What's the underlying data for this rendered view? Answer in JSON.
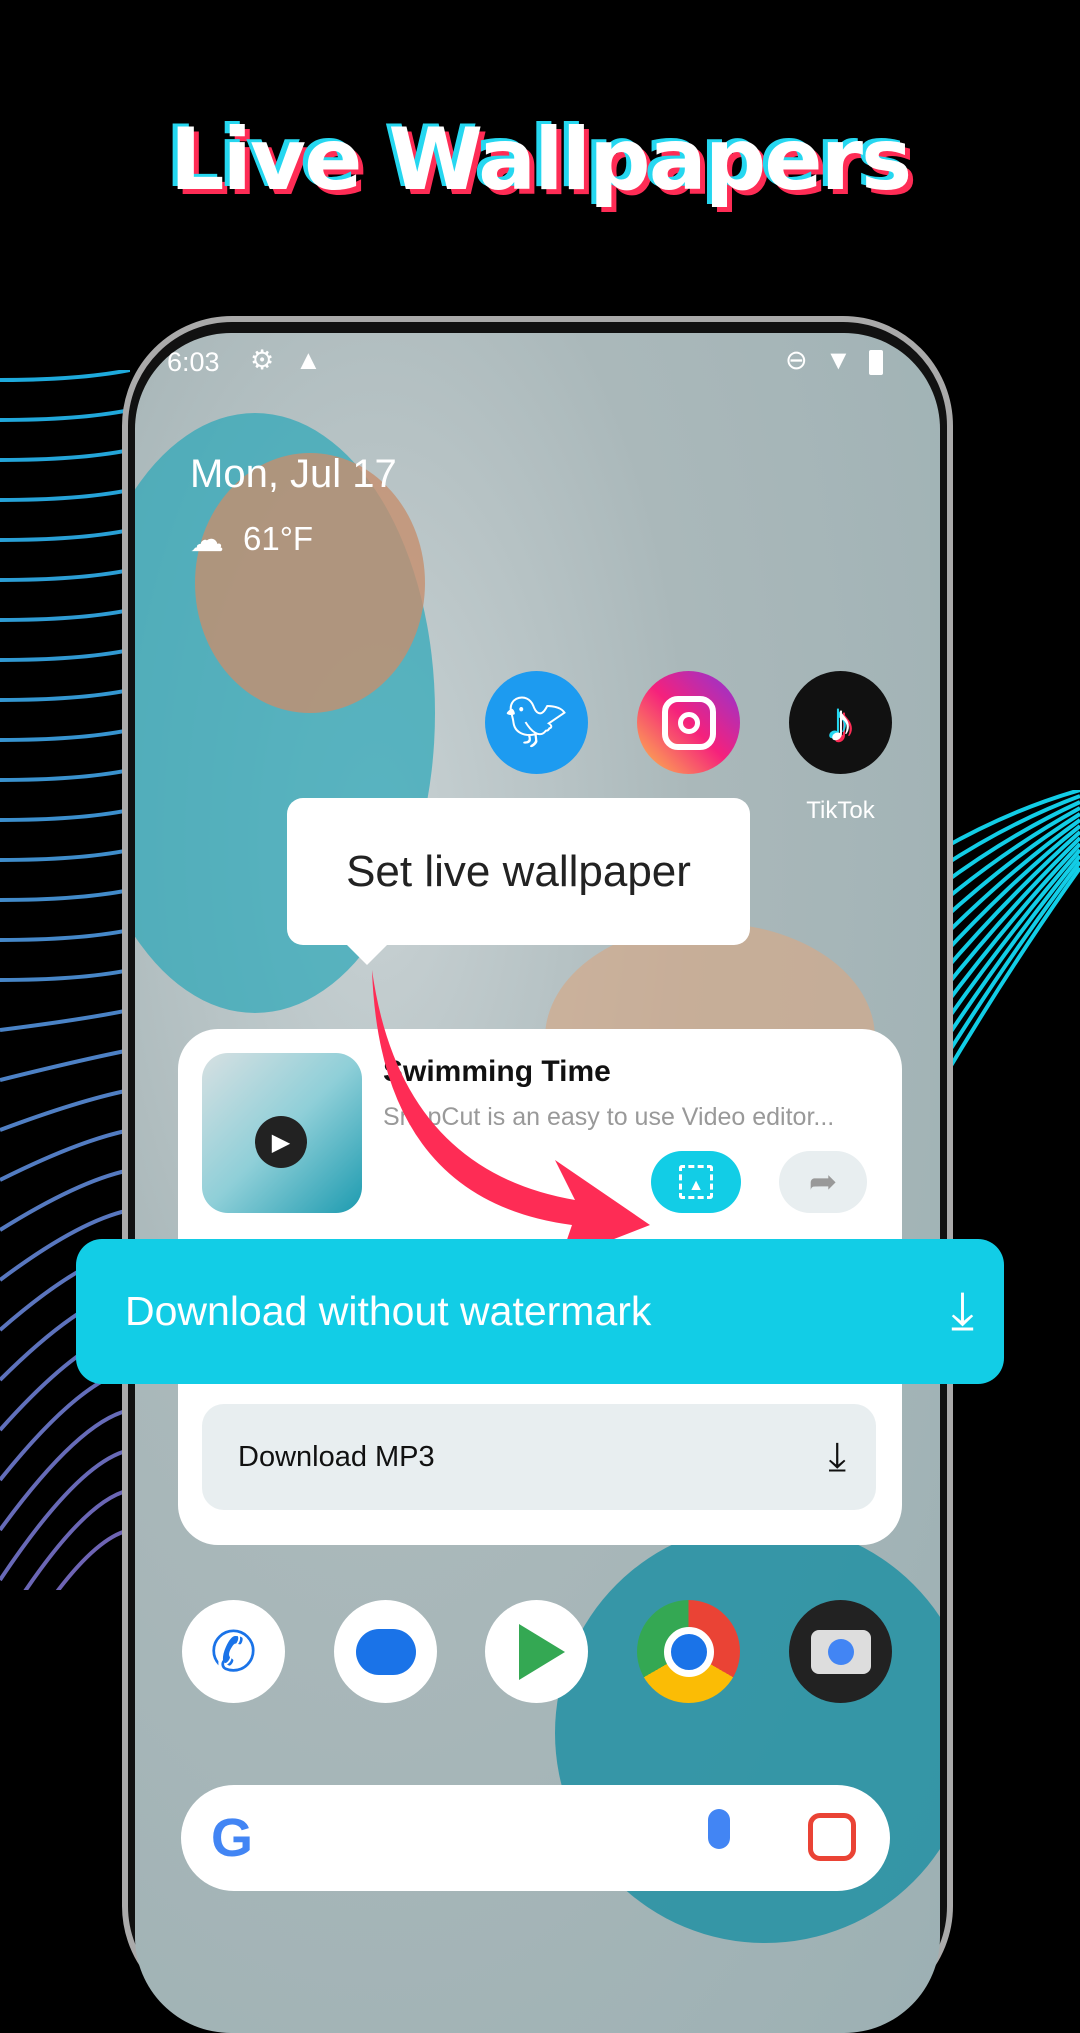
{
  "headline": "Live Wallpapers",
  "status_bar": {
    "time": "6:03",
    "icons": [
      "gear-icon",
      "warning-icon",
      "do-not-disturb-icon",
      "wifi-icon",
      "battery-icon"
    ]
  },
  "widget": {
    "date": "Mon, Jul 17",
    "weather_icon": "cloud-icon",
    "temperature": "61°F"
  },
  "apps": [
    {
      "icon": "twitter-icon",
      "color": "#1d9bf0"
    },
    {
      "icon": "instagram-icon"
    },
    {
      "icon": "tiktok-icon",
      "label": "TikTok"
    }
  ],
  "tooltip": "Set live wallpaper",
  "card": {
    "title": "Swimming Time",
    "subtitle": "SnapCut is an easy to use Video editor...",
    "set_wallpaper_icon": "wallpaper-icon",
    "share_icon": "share-icon"
  },
  "download_banner": {
    "label": "Download without watermark",
    "icon": "download-icon",
    "color": "#12cde6"
  },
  "download_mp3": {
    "label": "Download MP3",
    "icon": "download-icon"
  },
  "dock": [
    "phone-icon",
    "messages-icon",
    "play-store-icon",
    "chrome-icon",
    "camera-icon"
  ],
  "search": {
    "google_icon": "google-icon",
    "mic_icon": "mic-icon",
    "lens_icon": "lens-icon"
  },
  "colors": {
    "accent": "#12cde6",
    "arrow": "#fe2c55"
  }
}
